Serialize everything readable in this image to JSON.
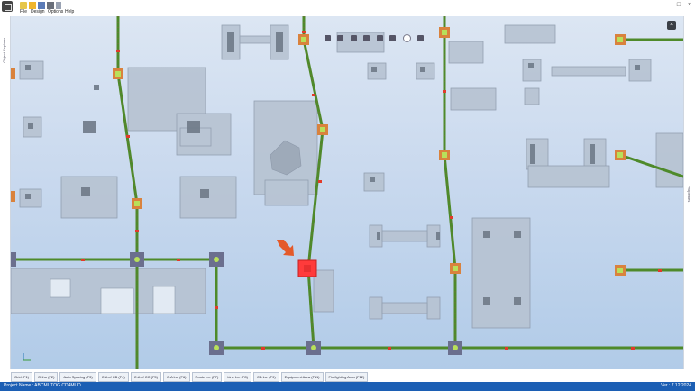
{
  "menu": [
    "File",
    "Design",
    "Options",
    "Help"
  ],
  "left_panel_label": "Object Explorer",
  "right_panel_label": "Properties",
  "tabs": [
    "Grid (F1)",
    "Ortho (F2)",
    "Auto Spacing (F3)",
    "C.A of CB (F4)",
    "C.A of CC (F5)",
    "C.A Lo. (F6)",
    "Route Lo. (F7)",
    "Line Lo. (F8)",
    "CB Lo. (F9)",
    "Equipment Area (F11)",
    "Firefighting Area (F12)"
  ],
  "status": {
    "project": "Project Name : ABCMUTOG CD4MUD",
    "version": "Ver : 7.12.2024"
  },
  "colors": {
    "titlebar": "#ffffff",
    "status_blue": "#1c5fb4",
    "cable_green": "#4e8a2a",
    "cable_brown": "#7a6a40",
    "junction_orange": "#d9823d",
    "junction_lime": "#b8e05a",
    "junction_gray": "#6b6f8e",
    "equipment_fill": "#b7c3d2",
    "highlight_red": "#ff3b3b",
    "arrow_orange": "#e45a2a"
  }
}
